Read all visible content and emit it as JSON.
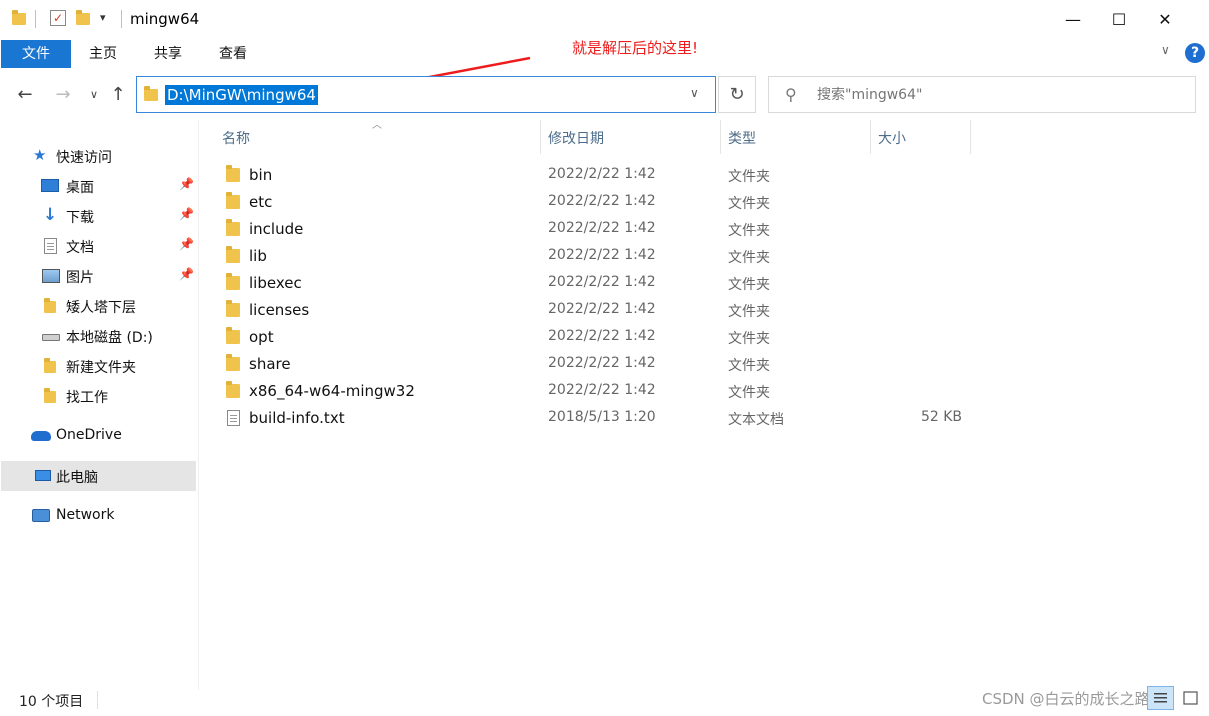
{
  "window": {
    "title": "mingw64",
    "minimize_glyph": "—",
    "maximize_glyph": "☐",
    "close_glyph": "✕"
  },
  "ribbon": {
    "tabs": [
      "文件",
      "主页",
      "共享",
      "查看"
    ],
    "help_glyph": "?",
    "expand_glyph": "∨"
  },
  "annotation": "就是解压后的这里!",
  "nav": {
    "back_glyph": "←",
    "forward_glyph": "→",
    "recent_glyph": "∨",
    "up_glyph": "↑",
    "address": "D:\\MinGW\\mingw64",
    "refresh_glyph": "↻",
    "search_placeholder": "搜索\"mingw64\""
  },
  "sidebar": {
    "items": [
      {
        "label": "快速访问",
        "icon": "star-icon",
        "pinned": false
      },
      {
        "label": "桌面",
        "icon": "desktop-icon",
        "pinned": true
      },
      {
        "label": "下载",
        "icon": "download-icon",
        "pinned": true
      },
      {
        "label": "文档",
        "icon": "document-icon",
        "pinned": true
      },
      {
        "label": "图片",
        "icon": "pictures-icon",
        "pinned": true
      },
      {
        "label": "矮人塔下层",
        "icon": "folder-icon",
        "pinned": false
      },
      {
        "label": "本地磁盘 (D:)",
        "icon": "drive-icon",
        "pinned": false
      },
      {
        "label": "新建文件夹",
        "icon": "folder-icon",
        "pinned": false
      },
      {
        "label": "找工作",
        "icon": "folder-icon",
        "pinned": false
      },
      {
        "label": "OneDrive",
        "icon": "cloud-icon",
        "pinned": false
      },
      {
        "label": "此电脑",
        "icon": "computer-icon",
        "pinned": false,
        "selected": true
      },
      {
        "label": "Network",
        "icon": "network-icon",
        "pinned": false
      }
    ],
    "pin_glyph": "📌"
  },
  "columns": {
    "name": "名称",
    "date": "修改日期",
    "type": "类型",
    "size": "大小"
  },
  "files": [
    {
      "name": "bin",
      "date": "2022/2/22 1:42",
      "type": "文件夹",
      "size": "",
      "kind": "folder"
    },
    {
      "name": "etc",
      "date": "2022/2/22 1:42",
      "type": "文件夹",
      "size": "",
      "kind": "folder"
    },
    {
      "name": "include",
      "date": "2022/2/22 1:42",
      "type": "文件夹",
      "size": "",
      "kind": "folder"
    },
    {
      "name": "lib",
      "date": "2022/2/22 1:42",
      "type": "文件夹",
      "size": "",
      "kind": "folder"
    },
    {
      "name": "libexec",
      "date": "2022/2/22 1:42",
      "type": "文件夹",
      "size": "",
      "kind": "folder"
    },
    {
      "name": "licenses",
      "date": "2022/2/22 1:42",
      "type": "文件夹",
      "size": "",
      "kind": "folder"
    },
    {
      "name": "opt",
      "date": "2022/2/22 1:42",
      "type": "文件夹",
      "size": "",
      "kind": "folder"
    },
    {
      "name": "share",
      "date": "2022/2/22 1:42",
      "type": "文件夹",
      "size": "",
      "kind": "folder"
    },
    {
      "name": "x86_64-w64-mingw32",
      "date": "2022/2/22 1:42",
      "type": "文件夹",
      "size": "",
      "kind": "folder"
    },
    {
      "name": "build-info.txt",
      "date": "2018/5/13 1:20",
      "type": "文本文档",
      "size": "52 KB",
      "kind": "text-file"
    }
  ],
  "status": {
    "item_count": "10 个项目"
  },
  "watermark": "CSDN @白云的成长之路",
  "colors": {
    "accent": "#1976d2",
    "selection": "#0078d7",
    "annotation": "#ee1c1c",
    "folder": "#f0c44c"
  }
}
